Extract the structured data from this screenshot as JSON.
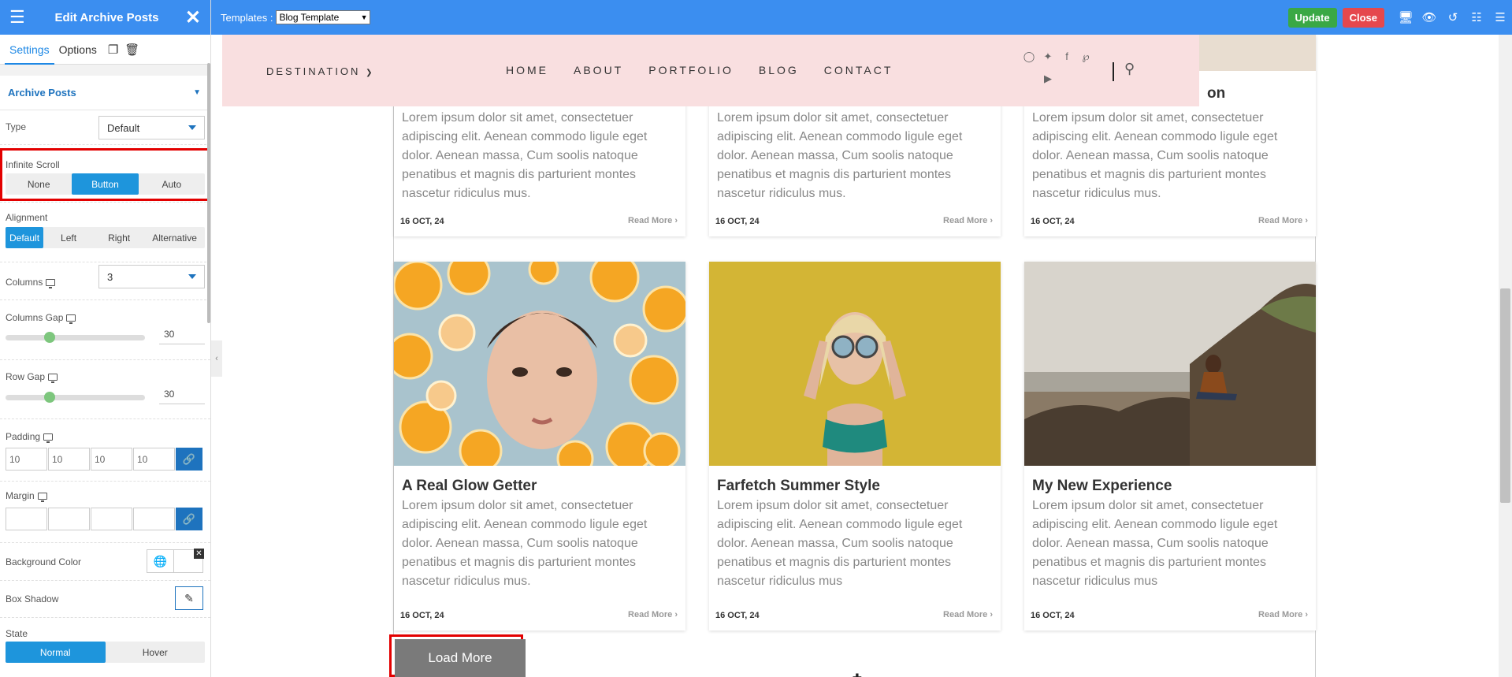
{
  "sidebar": {
    "title": "Edit Archive Posts",
    "tabs": [
      "Settings",
      "Options"
    ],
    "section": "Archive Posts",
    "type": {
      "label": "Type",
      "value": "Default"
    },
    "infinite_scroll": {
      "label": "Infinite Scroll",
      "options": [
        "None",
        "Button",
        "Auto"
      ],
      "selected": "Button"
    },
    "alignment": {
      "label": "Alignment",
      "options": [
        "Default",
        "Left",
        "Right",
        "Alternative"
      ],
      "selected": "Default"
    },
    "columns": {
      "label": "Columns",
      "value": "3"
    },
    "columns_gap": {
      "label": "Columns Gap",
      "value": "30"
    },
    "row_gap": {
      "label": "Row Gap",
      "value": "30"
    },
    "padding": {
      "label": "Padding",
      "values": [
        "10",
        "10",
        "10",
        "10"
      ]
    },
    "margin": {
      "label": "Margin",
      "values": [
        "",
        "",
        "",
        ""
      ]
    },
    "background_color": {
      "label": "Background Color"
    },
    "box_shadow": {
      "label": "Box Shadow"
    },
    "state": {
      "label": "State",
      "options": [
        "Normal",
        "Hover"
      ],
      "selected": "Normal"
    }
  },
  "topbar": {
    "templates_label": "Templates :",
    "template_value": "Blog Template",
    "update": "Update",
    "close": "Close",
    "icons": [
      "monitor-icon",
      "eye-icon",
      "history-icon",
      "sitemap-icon",
      "menu-icon"
    ]
  },
  "nav": {
    "dropdown": "DESTINATION",
    "menu": [
      "HOME",
      "ABOUT",
      "PORTFOLIO",
      "BLOG",
      "CONTACT"
    ],
    "social": [
      "instagram-icon",
      "twitter-icon",
      "facebook-icon",
      "pinterest-icon",
      "youtube-icon"
    ]
  },
  "posts_top": [
    {
      "excerpt": "Lorem ipsum dolor sit amet, consectetuer adipiscing elit. Aenean commodo ligule eget dolor. Aenean massa, Cum soolis natoque penatibus et magnis dis parturient montes nascetur ridiculus mus.",
      "date": "16 OCT, 24",
      "more": "Read More"
    },
    {
      "excerpt": "Lorem ipsum dolor sit amet, consectetuer adipiscing elit. Aenean commodo ligule eget dolor. Aenean massa, Cum soolis natoque penatibus et magnis dis parturient montes nascetur ridiculus mus.",
      "date": "16 OCT, 24",
      "more": "Read More"
    },
    {
      "title_tail": "on",
      "excerpt": "Lorem ipsum dolor sit amet, consectetuer adipiscing elit. Aenean commodo ligule eget dolor. Aenean massa, Cum soolis natoque penatibus et magnis dis parturient montes nascetur ridiculus mus.",
      "date": "16 OCT, 24",
      "more": "Read More"
    }
  ],
  "posts": [
    {
      "title": "A Real Glow Getter",
      "excerpt": "Lorem ipsum dolor sit amet, consectetuer adipiscing elit. Aenean commodo ligule eget dolor. Aenean massa, Cum soolis natoque penatibus et magnis dis parturient montes nascetur ridiculus mus.",
      "date": "16 OCT, 24",
      "more": "Read More"
    },
    {
      "title": "Farfetch Summer Style",
      "excerpt": "Lorem ipsum dolor sit amet, consectetuer adipiscing elit. Aenean commodo ligule eget dolor. Aenean massa, Cum soolis natoque penatibus et magnis dis parturient montes nascetur ridiculus mus",
      "date": "16 OCT, 24",
      "more": "Read More"
    },
    {
      "title": "My New Experience",
      "excerpt": "Lorem ipsum dolor sit amet, consectetuer adipiscing elit. Aenean commodo ligule eget dolor. Aenean massa, Cum soolis natoque penatibus et magnis dis parturient montes nascetur ridiculus mus",
      "date": "16 OCT, 24",
      "more": "Read More"
    }
  ],
  "load_more": "Load More",
  "colors": {
    "primary": "#3b8ef0",
    "segment_active": "#1e95dc",
    "update": "#3aa845",
    "close": "#e5484d",
    "nav_bg": "#f9dfe0",
    "highlight": "#e30000"
  }
}
